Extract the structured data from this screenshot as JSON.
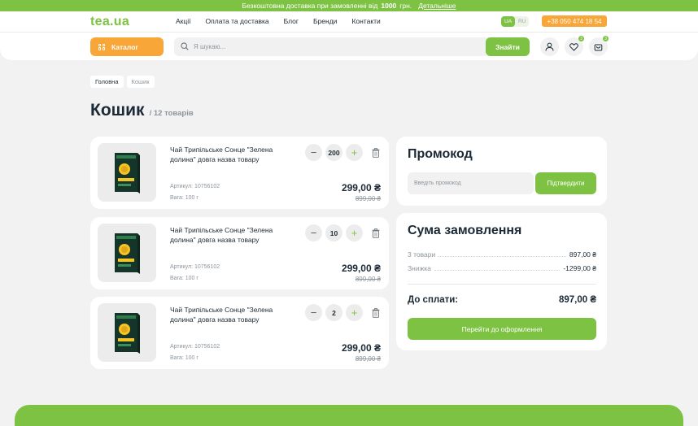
{
  "topbar": {
    "text": "Безкоштовна доставка при замовленні від",
    "amount": "1000",
    "currency": "грн.",
    "more": "Детальніше"
  },
  "header": {
    "logo": "tea.ua",
    "nav": [
      "Акції",
      "Оплата та доставка",
      "Блог",
      "Бренди",
      "Контакти"
    ],
    "lang": {
      "active": "UA",
      "other": "RU"
    },
    "phone": "+38 050 474 18 54",
    "catalog_label": "Каталог",
    "search_placeholder": "Я шукаю...",
    "search_button": "Знайти",
    "favorites_badge": "3",
    "cart_badge": "3"
  },
  "breadcrumbs": [
    "Головна",
    "Кошик"
  ],
  "page": {
    "title": "Кошик",
    "count": "/ 12 товарів"
  },
  "items": [
    {
      "name": "Чай Трипільське Сонце \"Зелена долина\" довга назва товару",
      "article": "Артикул: 10756102",
      "weight": "Вага: 100 г",
      "qty": "200",
      "price": "299,00 ₴",
      "old_price": "899,00 ₴"
    },
    {
      "name": "Чай Трипільське Сонце \"Зелена долина\" довга назва товару",
      "article": "Артикул: 10756102",
      "weight": "Вага: 100 г",
      "qty": "10",
      "price": "299,00 ₴",
      "old_price": "899,00 ₴"
    },
    {
      "name": "Чай Трипільське Сонце \"Зелена долина\" довга назва товару",
      "article": "Артикул: 10756102",
      "weight": "Вага: 100 г",
      "qty": "2",
      "price": "299,00 ₴",
      "old_price": "899,00 ₴"
    }
  ],
  "promo": {
    "title": "Промокод",
    "placeholder": "Введіть промокод",
    "button": "Підтвердити"
  },
  "summary": {
    "title": "Сума замовлення",
    "rows": [
      {
        "label": "3 товари",
        "value": "897,00 ₴"
      },
      {
        "label": "Знижка",
        "value": "-1299,00 ₴"
      }
    ],
    "total_label": "До сплати:",
    "total_value": "897,00 ₴",
    "checkout": "Перейти до оформлення"
  },
  "colors": {
    "accent": "#7dc243",
    "orange": "#f7a637",
    "text": "#1b2a36",
    "muted": "#8d959c",
    "bg": "#f2f2f2"
  }
}
